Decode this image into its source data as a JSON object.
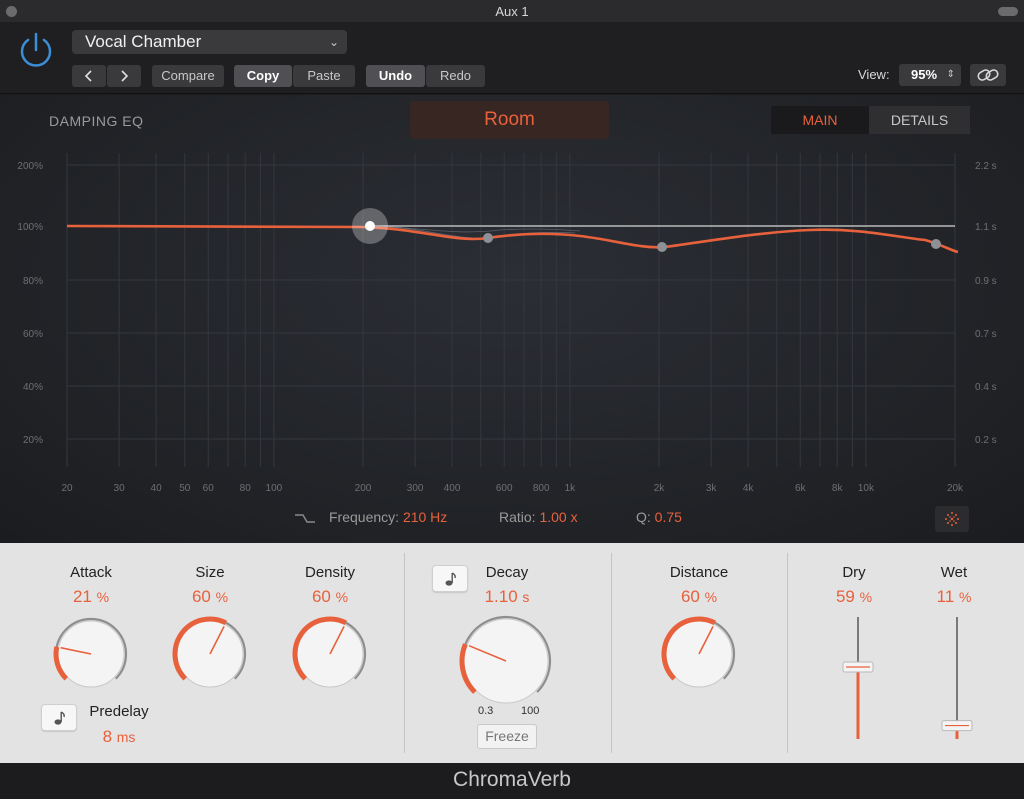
{
  "window": {
    "title": "Aux 1"
  },
  "header": {
    "preset_name": "Vocal Chamber",
    "compare_label": "Compare",
    "copy_label": "Copy",
    "paste_label": "Paste",
    "undo_label": "Undo",
    "redo_label": "Redo",
    "view_label": "View:",
    "view_value": "95%"
  },
  "graph": {
    "section_label": "DAMPING EQ",
    "room_label": "Room",
    "tab_main": "MAIN",
    "tab_details": "DETAILS",
    "left_axis": [
      "200%",
      "100%",
      "80%",
      "60%",
      "40%",
      "20%"
    ],
    "right_axis": [
      "2.2 s",
      "1.1 s",
      "0.9 s",
      "0.7 s",
      "0.4 s",
      "0.2 s"
    ],
    "freq_axis": [
      "20",
      "30",
      "40",
      "50",
      "60",
      "80",
      "100",
      "200",
      "300",
      "400",
      "600",
      "800",
      "1k",
      "2k",
      "3k",
      "4k",
      "6k",
      "8k",
      "10k",
      "20k"
    ],
    "frequency_label": "Frequency:",
    "frequency_value": "210 Hz",
    "ratio_label": "Ratio:",
    "ratio_value": "1.00 x",
    "q_label": "Q:",
    "q_value": "0.75"
  },
  "controls": {
    "attack": {
      "label": "Attack",
      "value": "21",
      "unit": "%",
      "level": 0.21
    },
    "size": {
      "label": "Size",
      "value": "60",
      "unit": "%",
      "level": 0.6
    },
    "density": {
      "label": "Density",
      "value": "60",
      "unit": "%",
      "level": 0.6
    },
    "predelay": {
      "label": "Predelay",
      "value": "8",
      "unit": "ms"
    },
    "decay": {
      "label": "Decay",
      "value": "1.10",
      "unit": "s",
      "scale_min": "0.3",
      "scale_max": "100",
      "level": 0.25
    },
    "freeze_label": "Freeze",
    "distance": {
      "label": "Distance",
      "value": "60",
      "unit": "%",
      "level": 0.6
    },
    "dry": {
      "label": "Dry",
      "value": "59",
      "unit": "%",
      "level": 0.59
    },
    "wet": {
      "label": "Wet",
      "value": "11",
      "unit": "%",
      "level": 0.11
    }
  },
  "footer": {
    "product_name": "ChromaVerb"
  },
  "colors": {
    "accent": "#e8613d",
    "power": "#3b8fd9",
    "panel": "#e3e3e3",
    "graph_bg": "#24262b"
  }
}
